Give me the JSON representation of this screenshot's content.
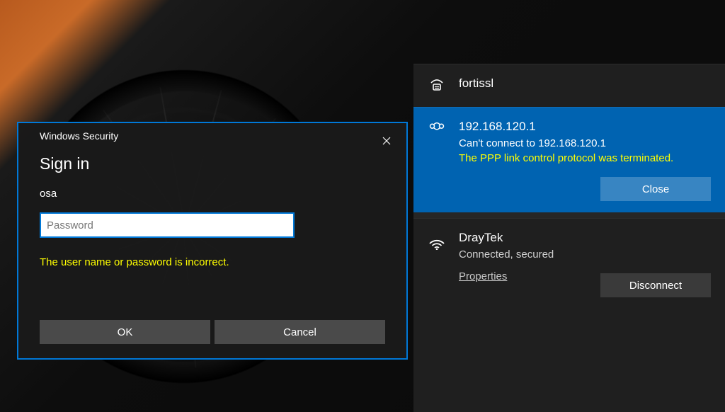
{
  "dialog": {
    "window_title": "Windows Security",
    "heading": "Sign in",
    "username": "osa",
    "password_placeholder": "Password",
    "password_value": "",
    "error": "The user name or password is incorrect.",
    "ok_label": "OK",
    "cancel_label": "Cancel"
  },
  "network": {
    "items": [
      {
        "name": "fortissl",
        "icon": "dialup"
      },
      {
        "name": "192.168.120.1",
        "icon": "vpn",
        "status": "Can't connect to 192.168.120.1",
        "error": "The PPP link control protocol was terminated.",
        "action": "Close",
        "selected": true
      },
      {
        "name": "DrayTek",
        "icon": "wifi",
        "status": "Connected, secured",
        "link": "Properties",
        "action": "Disconnect"
      }
    ]
  }
}
